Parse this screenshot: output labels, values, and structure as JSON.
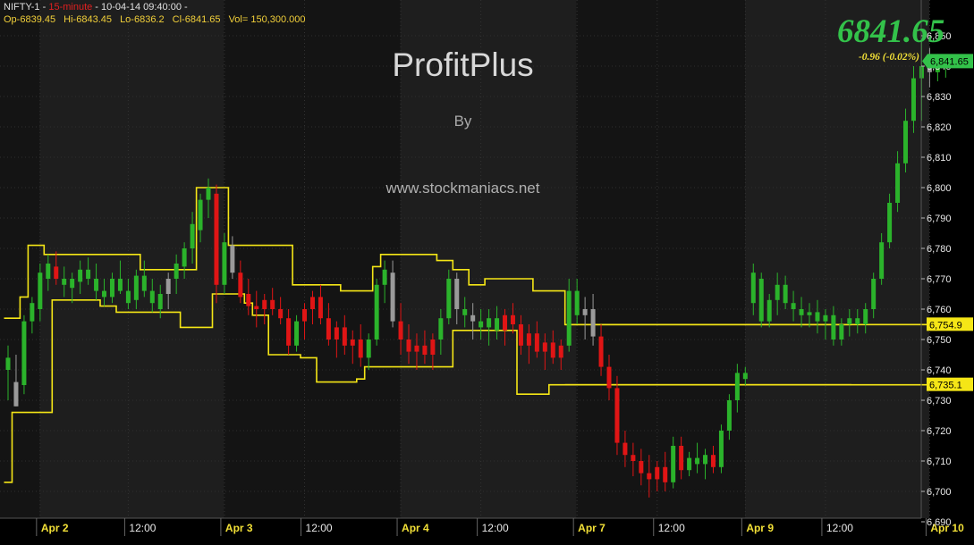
{
  "header": {
    "symbol": "NIFTY-1",
    "timeframe": "15-minute",
    "datetime": "10-04-14 09:40:00",
    "open": "Op-6839.45",
    "high": "Hi-6843.45",
    "low": "Lo-6836.2",
    "close": "Cl-6841.65",
    "volume": "Vol= 150,300.000"
  },
  "watermark": {
    "title": "ProfitPlus",
    "by": "By",
    "url": "www.stockmaniacs.net"
  },
  "last_price_big": "6841.65",
  "change_text": "-0.96  (-0.02%)",
  "colors": {
    "background": "#000000",
    "bull": "#2bb32b",
    "bear": "#e01515",
    "neutral": "#9a9a9a",
    "channel": "#f5e616",
    "price_badge": "#33c24a",
    "level_badge": "#f5e616"
  },
  "chart_data": {
    "type": "candlestick",
    "timeframe": "15-minute",
    "ylim": [
      6690,
      6860
    ],
    "y_ticks": [
      "6,690",
      "6,700",
      "6,710",
      "6,720",
      "6,730",
      "6,740",
      "6,750",
      "6,760",
      "6,770",
      "6,780",
      "6,790",
      "6,800",
      "6,810",
      "6,820",
      "6,830",
      "6,840",
      "6,850"
    ],
    "x_labels": [
      "Apr 2",
      "12:00",
      "Apr 3",
      "12:00",
      "Apr 4",
      "12:00",
      "Apr 7",
      "12:00",
      "Apr 9",
      "12:00",
      "Apr 10"
    ],
    "x_label_bars": [
      4,
      15,
      27,
      37,
      49,
      59,
      71,
      81,
      92,
      102,
      115
    ],
    "last_price": "6,841.65",
    "horizontal_levels": [
      "6,754.9",
      "6,735.1"
    ],
    "horizontal_level_values": [
      6754.9,
      6735.1
    ],
    "horizontal_levels_from_bar": 70,
    "candles": [
      {
        "o": 6740,
        "h": 6748,
        "l": 6730,
        "c": 6744,
        "k": "u"
      },
      {
        "o": 6736,
        "h": 6745,
        "l": 6728,
        "c": 6728,
        "k": "n"
      },
      {
        "o": 6735,
        "h": 6758,
        "l": 6732,
        "c": 6756,
        "k": "u"
      },
      {
        "o": 6756,
        "h": 6764,
        "l": 6752,
        "c": 6762,
        "k": "u"
      },
      {
        "o": 6760,
        "h": 6775,
        "l": 6756,
        "c": 6772,
        "k": "u"
      },
      {
        "o": 6770,
        "h": 6778,
        "l": 6766,
        "c": 6775,
        "k": "u"
      },
      {
        "o": 6774,
        "h": 6779,
        "l": 6768,
        "c": 6770,
        "k": "d"
      },
      {
        "o": 6770,
        "h": 6774,
        "l": 6764,
        "c": 6768,
        "k": "u"
      },
      {
        "o": 6767,
        "h": 6772,
        "l": 6762,
        "c": 6770,
        "k": "u"
      },
      {
        "o": 6769,
        "h": 6776,
        "l": 6765,
        "c": 6773,
        "k": "u"
      },
      {
        "o": 6773,
        "h": 6777,
        "l": 6768,
        "c": 6770,
        "k": "u"
      },
      {
        "o": 6770,
        "h": 6775,
        "l": 6763,
        "c": 6766,
        "k": "u"
      },
      {
        "o": 6766,
        "h": 6770,
        "l": 6761,
        "c": 6764,
        "k": "u"
      },
      {
        "o": 6764,
        "h": 6772,
        "l": 6762,
        "c": 6770,
        "k": "u"
      },
      {
        "o": 6770,
        "h": 6776,
        "l": 6765,
        "c": 6766,
        "k": "u"
      },
      {
        "o": 6766,
        "h": 6770,
        "l": 6760,
        "c": 6762,
        "k": "u"
      },
      {
        "o": 6763,
        "h": 6773,
        "l": 6760,
        "c": 6771,
        "k": "u"
      },
      {
        "o": 6771,
        "h": 6776,
        "l": 6764,
        "c": 6766,
        "k": "u"
      },
      {
        "o": 6766,
        "h": 6770,
        "l": 6759,
        "c": 6762,
        "k": "u"
      },
      {
        "o": 6760,
        "h": 6768,
        "l": 6757,
        "c": 6765,
        "k": "u"
      },
      {
        "o": 6765,
        "h": 6772,
        "l": 6760,
        "c": 6770,
        "k": "n"
      },
      {
        "o": 6770,
        "h": 6778,
        "l": 6765,
        "c": 6775,
        "k": "u"
      },
      {
        "o": 6774,
        "h": 6782,
        "l": 6770,
        "c": 6780,
        "k": "u"
      },
      {
        "o": 6780,
        "h": 6792,
        "l": 6775,
        "c": 6788,
        "k": "u"
      },
      {
        "o": 6786,
        "h": 6798,
        "l": 6782,
        "c": 6796,
        "k": "u"
      },
      {
        "o": 6796,
        "h": 6803,
        "l": 6790,
        "c": 6800,
        "k": "u"
      },
      {
        "o": 6798,
        "h": 6801,
        "l": 6762,
        "c": 6768,
        "k": "d"
      },
      {
        "o": 6768,
        "h": 6785,
        "l": 6765,
        "c": 6782,
        "k": "u"
      },
      {
        "o": 6781,
        "h": 6784,
        "l": 6770,
        "c": 6772,
        "k": "n"
      },
      {
        "o": 6772,
        "h": 6776,
        "l": 6762,
        "c": 6764,
        "k": "d"
      },
      {
        "o": 6765,
        "h": 6770,
        "l": 6758,
        "c": 6761,
        "k": "d"
      },
      {
        "o": 6761,
        "h": 6766,
        "l": 6754,
        "c": 6760,
        "k": "d"
      },
      {
        "o": 6760,
        "h": 6765,
        "l": 6755,
        "c": 6763,
        "k": "d"
      },
      {
        "o": 6763,
        "h": 6767,
        "l": 6758,
        "c": 6760,
        "k": "d"
      },
      {
        "o": 6760,
        "h": 6764,
        "l": 6755,
        "c": 6757,
        "k": "d"
      },
      {
        "o": 6757,
        "h": 6760,
        "l": 6745,
        "c": 6748,
        "k": "d"
      },
      {
        "o": 6748,
        "h": 6758,
        "l": 6746,
        "c": 6756,
        "k": "u"
      },
      {
        "o": 6756,
        "h": 6762,
        "l": 6750,
        "c": 6760,
        "k": "d"
      },
      {
        "o": 6760,
        "h": 6766,
        "l": 6755,
        "c": 6764,
        "k": "d"
      },
      {
        "o": 6764,
        "h": 6768,
        "l": 6755,
        "c": 6757,
        "k": "d"
      },
      {
        "o": 6757,
        "h": 6762,
        "l": 6748,
        "c": 6750,
        "k": "d"
      },
      {
        "o": 6750,
        "h": 6756,
        "l": 6744,
        "c": 6754,
        "k": "d"
      },
      {
        "o": 6754,
        "h": 6758,
        "l": 6745,
        "c": 6748,
        "k": "d"
      },
      {
        "o": 6748,
        "h": 6753,
        "l": 6742,
        "c": 6750,
        "k": "d"
      },
      {
        "o": 6750,
        "h": 6755,
        "l": 6741,
        "c": 6744,
        "k": "d"
      },
      {
        "o": 6744,
        "h": 6752,
        "l": 6740,
        "c": 6750,
        "k": "u"
      },
      {
        "o": 6750,
        "h": 6770,
        "l": 6748,
        "c": 6768,
        "k": "u"
      },
      {
        "o": 6768,
        "h": 6776,
        "l": 6762,
        "c": 6773,
        "k": "u"
      },
      {
        "o": 6772,
        "h": 6776,
        "l": 6754,
        "c": 6756,
        "k": "n"
      },
      {
        "o": 6756,
        "h": 6762,
        "l": 6745,
        "c": 6750,
        "k": "d"
      },
      {
        "o": 6750,
        "h": 6755,
        "l": 6742,
        "c": 6746,
        "k": "d"
      },
      {
        "o": 6746,
        "h": 6752,
        "l": 6740,
        "c": 6748,
        "k": "d"
      },
      {
        "o": 6748,
        "h": 6753,
        "l": 6742,
        "c": 6745,
        "k": "d"
      },
      {
        "o": 6745,
        "h": 6752,
        "l": 6740,
        "c": 6750,
        "k": "d"
      },
      {
        "o": 6750,
        "h": 6760,
        "l": 6745,
        "c": 6757,
        "k": "u"
      },
      {
        "o": 6757,
        "h": 6773,
        "l": 6755,
        "c": 6770,
        "k": "u"
      },
      {
        "o": 6770,
        "h": 6772,
        "l": 6755,
        "c": 6760,
        "k": "n"
      },
      {
        "o": 6760,
        "h": 6764,
        "l": 6754,
        "c": 6758,
        "k": "u"
      },
      {
        "o": 6758,
        "h": 6762,
        "l": 6750,
        "c": 6756,
        "k": "n"
      },
      {
        "o": 6756,
        "h": 6760,
        "l": 6750,
        "c": 6754,
        "k": "u"
      },
      {
        "o": 6754,
        "h": 6760,
        "l": 6748,
        "c": 6757,
        "k": "u"
      },
      {
        "o": 6757,
        "h": 6761,
        "l": 6750,
        "c": 6753,
        "k": "u"
      },
      {
        "o": 6753,
        "h": 6760,
        "l": 6748,
        "c": 6758,
        "k": "d"
      },
      {
        "o": 6758,
        "h": 6762,
        "l": 6752,
        "c": 6755,
        "k": "d"
      },
      {
        "o": 6755,
        "h": 6758,
        "l": 6745,
        "c": 6748,
        "k": "d"
      },
      {
        "o": 6748,
        "h": 6755,
        "l": 6742,
        "c": 6752,
        "k": "d"
      },
      {
        "o": 6752,
        "h": 6756,
        "l": 6744,
        "c": 6746,
        "k": "d"
      },
      {
        "o": 6746,
        "h": 6752,
        "l": 6740,
        "c": 6749,
        "k": "d"
      },
      {
        "o": 6749,
        "h": 6753,
        "l": 6742,
        "c": 6744,
        "k": "d"
      },
      {
        "o": 6744,
        "h": 6750,
        "l": 6740,
        "c": 6748,
        "k": "d"
      },
      {
        "o": 6748,
        "h": 6770,
        "l": 6746,
        "c": 6766,
        "k": "u"
      },
      {
        "o": 6766,
        "h": 6770,
        "l": 6755,
        "c": 6758,
        "k": "u"
      },
      {
        "o": 6758,
        "h": 6764,
        "l": 6750,
        "c": 6760,
        "k": "n"
      },
      {
        "o": 6760,
        "h": 6765,
        "l": 6748,
        "c": 6751,
        "k": "n"
      },
      {
        "o": 6751,
        "h": 6755,
        "l": 6738,
        "c": 6741,
        "k": "d"
      },
      {
        "o": 6741,
        "h": 6745,
        "l": 6730,
        "c": 6734,
        "k": "d"
      },
      {
        "o": 6734,
        "h": 6738,
        "l": 6712,
        "c": 6716,
        "k": "d"
      },
      {
        "o": 6716,
        "h": 6720,
        "l": 6708,
        "c": 6712,
        "k": "d"
      },
      {
        "o": 6712,
        "h": 6716,
        "l": 6705,
        "c": 6710,
        "k": "d"
      },
      {
        "o": 6710,
        "h": 6714,
        "l": 6702,
        "c": 6706,
        "k": "d"
      },
      {
        "o": 6706,
        "h": 6712,
        "l": 6698,
        "c": 6704,
        "k": "d"
      },
      {
        "o": 6704,
        "h": 6710,
        "l": 6700,
        "c": 6708,
        "k": "d"
      },
      {
        "o": 6708,
        "h": 6713,
        "l": 6700,
        "c": 6703,
        "k": "d"
      },
      {
        "o": 6703,
        "h": 6718,
        "l": 6701,
        "c": 6715,
        "k": "u"
      },
      {
        "o": 6715,
        "h": 6718,
        "l": 6704,
        "c": 6707,
        "k": "d"
      },
      {
        "o": 6707,
        "h": 6713,
        "l": 6705,
        "c": 6711,
        "k": "u"
      },
      {
        "o": 6711,
        "h": 6716,
        "l": 6706,
        "c": 6709,
        "k": "u"
      },
      {
        "o": 6709,
        "h": 6714,
        "l": 6704,
        "c": 6712,
        "k": "u"
      },
      {
        "o": 6712,
        "h": 6715,
        "l": 6706,
        "c": 6708,
        "k": "d"
      },
      {
        "o": 6708,
        "h": 6722,
        "l": 6706,
        "c": 6720,
        "k": "u"
      },
      {
        "o": 6720,
        "h": 6732,
        "l": 6717,
        "c": 6730,
        "k": "u"
      },
      {
        "o": 6730,
        "h": 6742,
        "l": 6726,
        "c": 6739,
        "k": "u"
      },
      {
        "o": 6739,
        "h": 6741,
        "l": 6735,
        "c": 6737,
        "k": "u"
      },
      {
        "o": 6762,
        "h": 6775,
        "l": 6758,
        "c": 6772,
        "k": "u"
      },
      {
        "o": 6770,
        "h": 6772,
        "l": 6754,
        "c": 6756,
        "k": "u"
      },
      {
        "o": 6756,
        "h": 6765,
        "l": 6754,
        "c": 6763,
        "k": "u"
      },
      {
        "o": 6763,
        "h": 6772,
        "l": 6758,
        "c": 6768,
        "k": "u"
      },
      {
        "o": 6768,
        "h": 6771,
        "l": 6760,
        "c": 6762,
        "k": "u"
      },
      {
        "o": 6762,
        "h": 6766,
        "l": 6756,
        "c": 6760,
        "k": "u"
      },
      {
        "o": 6760,
        "h": 6764,
        "l": 6754,
        "c": 6758,
        "k": "u"
      },
      {
        "o": 6758,
        "h": 6762,
        "l": 6754,
        "c": 6759,
        "k": "u"
      },
      {
        "o": 6759,
        "h": 6763,
        "l": 6752,
        "c": 6756,
        "k": "u"
      },
      {
        "o": 6756,
        "h": 6760,
        "l": 6750,
        "c": 6758,
        "k": "u"
      },
      {
        "o": 6758,
        "h": 6761,
        "l": 6748,
        "c": 6750,
        "k": "u"
      },
      {
        "o": 6750,
        "h": 6757,
        "l": 6748,
        "c": 6755,
        "k": "u"
      },
      {
        "o": 6755,
        "h": 6760,
        "l": 6751,
        "c": 6757,
        "k": "u"
      },
      {
        "o": 6757,
        "h": 6760,
        "l": 6752,
        "c": 6755,
        "k": "u"
      },
      {
        "o": 6755,
        "h": 6762,
        "l": 6752,
        "c": 6760,
        "k": "u"
      },
      {
        "o": 6760,
        "h": 6772,
        "l": 6757,
        "c": 6770,
        "k": "u"
      },
      {
        "o": 6770,
        "h": 6785,
        "l": 6768,
        "c": 6782,
        "k": "u"
      },
      {
        "o": 6782,
        "h": 6798,
        "l": 6780,
        "c": 6795,
        "k": "u"
      },
      {
        "o": 6795,
        "h": 6812,
        "l": 6792,
        "c": 6808,
        "k": "u"
      },
      {
        "o": 6808,
        "h": 6826,
        "l": 6805,
        "c": 6822,
        "k": "u"
      },
      {
        "o": 6822,
        "h": 6840,
        "l": 6818,
        "c": 6836,
        "k": "u"
      },
      {
        "o": 6836,
        "h": 6848,
        "l": 6822,
        "c": 6840,
        "k": "u"
      },
      {
        "o": 6840,
        "h": 6846,
        "l": 6833,
        "c": 6838,
        "k": "n"
      },
      {
        "o": 6838,
        "h": 6844,
        "l": 6835,
        "c": 6841,
        "k": "u"
      },
      {
        "o": 6839.45,
        "h": 6843.45,
        "l": 6836.2,
        "c": 6841.65,
        "k": "u"
      }
    ],
    "channel_upper": [
      6757,
      6757,
      6764,
      6781,
      6781,
      6778,
      6778,
      6778,
      6778,
      6778,
      6778,
      6778,
      6778,
      6778,
      6778,
      6778,
      6778,
      6773,
      6773,
      6773,
      6773,
      6773,
      6773,
      6773,
      6800,
      6800,
      6800,
      6800,
      6781,
      6781,
      6781,
      6781,
      6781,
      6781,
      6781,
      6781,
      6768,
      6768,
      6768,
      6768,
      6768,
      6768,
      6766,
      6766,
      6766,
      6766,
      6774,
      6778,
      6778,
      6778,
      6778,
      6778,
      6778,
      6778,
      6776,
      6776,
      6773,
      6773,
      6768,
      6768,
      6770,
      6770,
      6770,
      6770,
      6770,
      6770,
      6766,
      6766,
      6766,
      6766,
      6754.9,
      6754.9,
      6754.9,
      6754.9,
      6754.9,
      6754.9,
      6754.9,
      6754.9,
      6754.9,
      6754.9,
      6754.9,
      6754.9,
      6754.9,
      6754.9,
      6754.9,
      6754.9,
      6754.9,
      6754.9,
      6754.9,
      6754.9,
      6754.9,
      6754.9,
      6754.9,
      6754.9,
      6754.9,
      6754.9,
      6754.9,
      6754.9,
      6754.9,
      6754.9,
      6754.9,
      6754.9,
      6754.9,
      6754.9,
      6754.9,
      6754.9,
      6754.9,
      6754.9,
      6754.9,
      6754.9,
      6754.9,
      6754.9,
      6754.9,
      6754.9,
      6754.9,
      6754.9,
      6754.9,
      6754.9,
      6754.9,
      6754.9
    ],
    "channel_lower": [
      6703,
      6726,
      6726,
      6726,
      6726,
      6726,
      6763,
      6763,
      6763,
      6763,
      6763,
      6763,
      6761,
      6761,
      6759,
      6759,
      6759,
      6759,
      6759,
      6759,
      6759,
      6759,
      6754,
      6754,
      6754,
      6754,
      6765,
      6765,
      6765,
      6765,
      6762,
      6758,
      6758,
      6745,
      6745,
      6745,
      6745,
      6744,
      6744,
      6736,
      6736,
      6736,
      6736,
      6736,
      6737,
      6741,
      6741,
      6741,
      6741,
      6741,
      6741,
      6741,
      6741,
      6741,
      6741,
      6741,
      6753,
      6753,
      6753,
      6753,
      6753,
      6753,
      6753,
      6753,
      6732,
      6732,
      6732,
      6732,
      6735.1,
      6735.1,
      6735.1,
      6735.1,
      6735.1,
      6735.1,
      6735.1,
      6735.1,
      6735.1,
      6735.1,
      6735.1,
      6735.1,
      6735.1,
      6735.1,
      6735.1,
      6735.1,
      6735.1,
      6735.1,
      6735.1,
      6735.1,
      6735.1,
      6735.1,
      6735.1,
      6735.1,
      6735.1,
      6735.1,
      6735.1,
      6735.1,
      6735.1,
      6735.1,
      6735.1,
      6735.1,
      6735.1,
      6735.1,
      6735.1,
      6735.1,
      6735.1,
      6735.1,
      6735.1,
      6735.1,
      6735.1,
      6735.1,
      6735.1,
      6735.1,
      6735.1,
      6735.1,
      6735.1,
      6735.1,
      6735.1,
      6735.1,
      6735.1,
      6735.1
    ]
  }
}
